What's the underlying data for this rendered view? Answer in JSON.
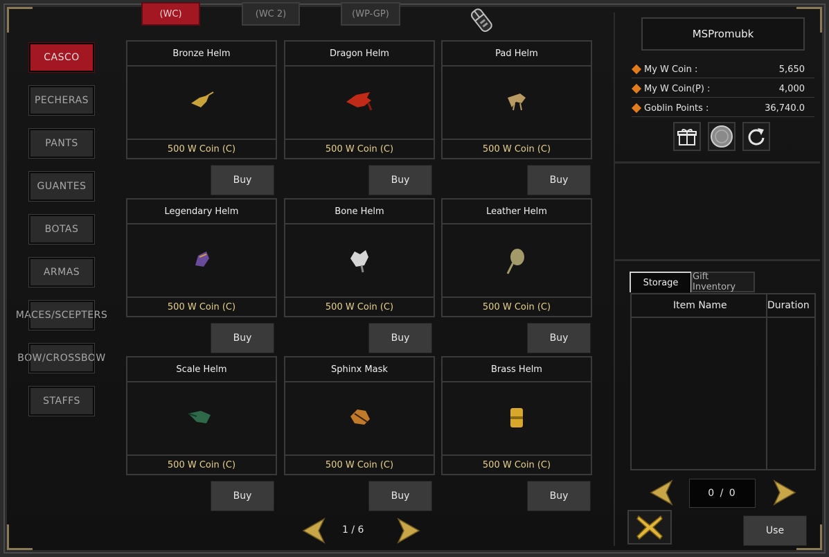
{
  "top_tabs": [
    {
      "label": "(WC)",
      "active": true
    },
    {
      "label": "(WC 2)",
      "active": false
    },
    {
      "label": "(WP-GP)",
      "active": false
    }
  ],
  "categories": [
    {
      "label": "CASCO",
      "active": true
    },
    {
      "label": "PECHERAS",
      "active": false
    },
    {
      "label": "PANTS",
      "active": false
    },
    {
      "label": "GUANTES",
      "active": false
    },
    {
      "label": "BOTAS",
      "active": false
    },
    {
      "label": "ARMAS",
      "active": false
    },
    {
      "label": "MACES/SCEPTERS",
      "active": false
    },
    {
      "label": "BOW/CROSSBOW",
      "active": false
    },
    {
      "label": "STAFFS",
      "active": false
    }
  ],
  "items": [
    {
      "name": "Bronze Helm",
      "price": "500 W Coin (C)",
      "buy": "Buy",
      "icon": "bronze-helm-icon",
      "color": "#c9a23a"
    },
    {
      "name": "Dragon Helm",
      "price": "500 W Coin (C)",
      "buy": "Buy",
      "icon": "dragon-helm-icon",
      "color": "#c02a16"
    },
    {
      "name": "Pad Helm",
      "price": "500 W Coin (C)",
      "buy": "Buy",
      "icon": "pad-helm-icon",
      "color": "#b99a62"
    },
    {
      "name": "Legendary Helm",
      "price": "500 W Coin (C)",
      "buy": "Buy",
      "icon": "legendary-helm-icon",
      "color": "#6a4a9a"
    },
    {
      "name": "Bone Helm",
      "price": "500 W Coin (C)",
      "buy": "Buy",
      "icon": "bone-helm-icon",
      "color": "#d5d5d5"
    },
    {
      "name": "Leather Helm",
      "price": "500 W Coin (C)",
      "buy": "Buy",
      "icon": "leather-helm-icon",
      "color": "#a39a6a"
    },
    {
      "name": "Scale Helm",
      "price": "500 W Coin (C)",
      "buy": "Buy",
      "icon": "scale-helm-icon",
      "color": "#2e6a4a"
    },
    {
      "name": "Sphinx Mask",
      "price": "500 W Coin (C)",
      "buy": "Buy",
      "icon": "sphinx-mask-icon",
      "color": "#c07a2a"
    },
    {
      "name": "Brass Helm",
      "price": "500 W Coin (C)",
      "buy": "Buy",
      "icon": "brass-helm-icon",
      "color": "#d9a72a"
    }
  ],
  "pager": {
    "text": "1 / 6"
  },
  "user": {
    "name": "MSPromubk"
  },
  "balances": [
    {
      "label": "My W Coin :",
      "value": "5,650"
    },
    {
      "label": "My W Coin(P) :",
      "value": "4,000"
    },
    {
      "label": "Goblin Points :",
      "value": "36,740.0"
    }
  ],
  "storage": {
    "tabs": [
      {
        "label": "Storage",
        "active": true
      },
      {
        "label": "Gift Inventory",
        "active": false
      }
    ],
    "col_item": "Item Name",
    "col_duration": "Duration",
    "page": "0 / 0",
    "use": "Use"
  },
  "colors": {
    "accent_red": "#a31722",
    "gold": "#e8d28a",
    "arrow_gold": "#c9a748"
  }
}
